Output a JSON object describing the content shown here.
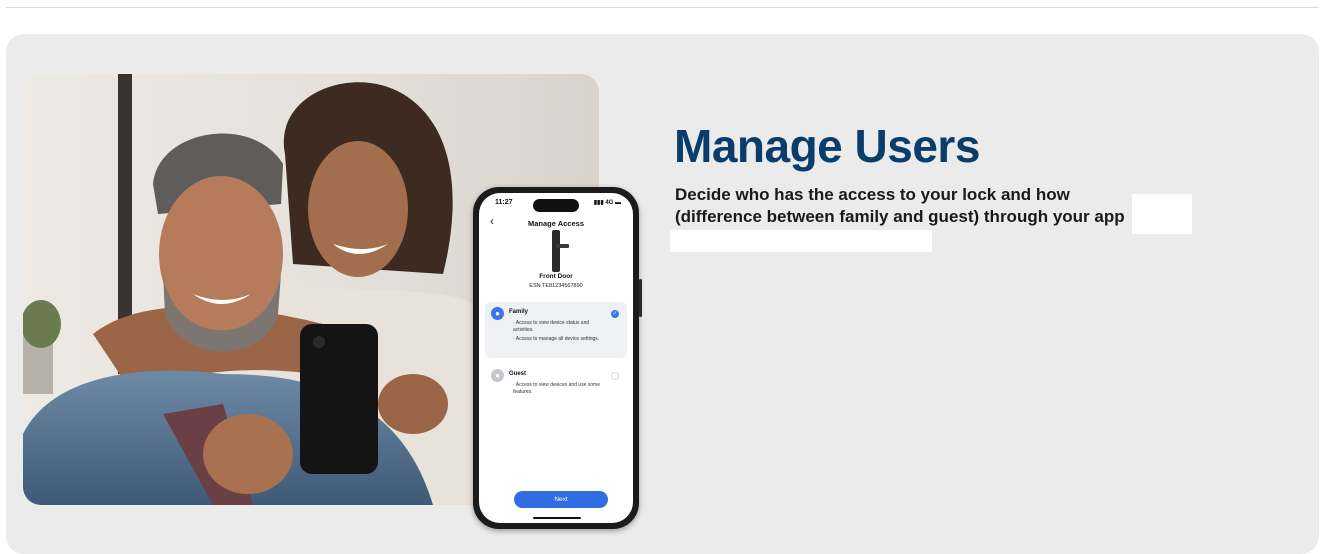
{
  "hero": {
    "title": "Manage Users",
    "description": "Decide who has the access to your lock and how (difference between family and guest)  through your app"
  },
  "photo": {
    "subject": "couple-smiling-at-phone-photo"
  },
  "phone_screen": {
    "status_time": "11:27",
    "status_signal": "4G",
    "title": "Manage Access",
    "device_name": "Front Door",
    "device_esn": "ESN TE81234567890",
    "options": [
      {
        "label": "Family",
        "selected": true,
        "lines": [
          "· Access to view device status and activities.",
          "· Access to manage all device settings."
        ]
      },
      {
        "label": "Guest",
        "selected": false,
        "lines": [
          "· Access to view devices and use some features."
        ]
      }
    ],
    "next_label": "Next"
  },
  "colors": {
    "headline": "#0a3d6b",
    "card_background": "#ebebec",
    "accent_blue": "#2f6de1"
  }
}
